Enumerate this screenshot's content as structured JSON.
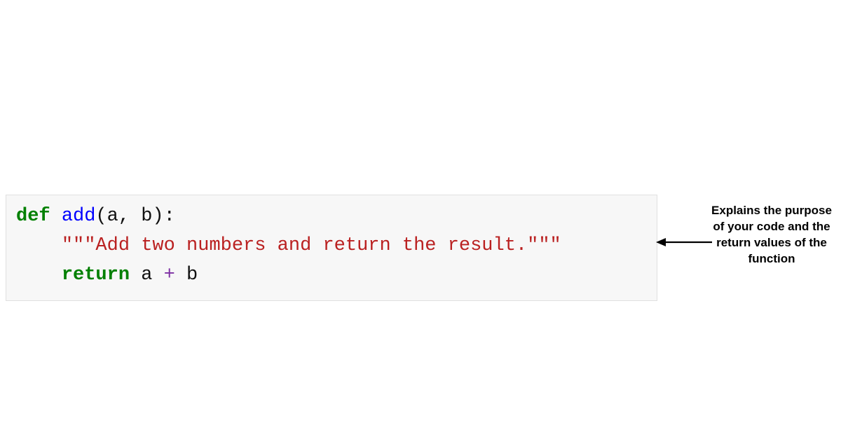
{
  "code": {
    "def_kw": "def",
    "space1": " ",
    "fn_name": "add",
    "params_open": "(a, b):",
    "indent": "    ",
    "docstring": "\"\"\"Add two numbers and return the result.\"\"\"",
    "return_kw": "return",
    "space2": " ",
    "var_a": "a ",
    "op": "+",
    "var_b": " b"
  },
  "annotation": {
    "text": "Explains the purpose of your code and the return values of the function"
  }
}
